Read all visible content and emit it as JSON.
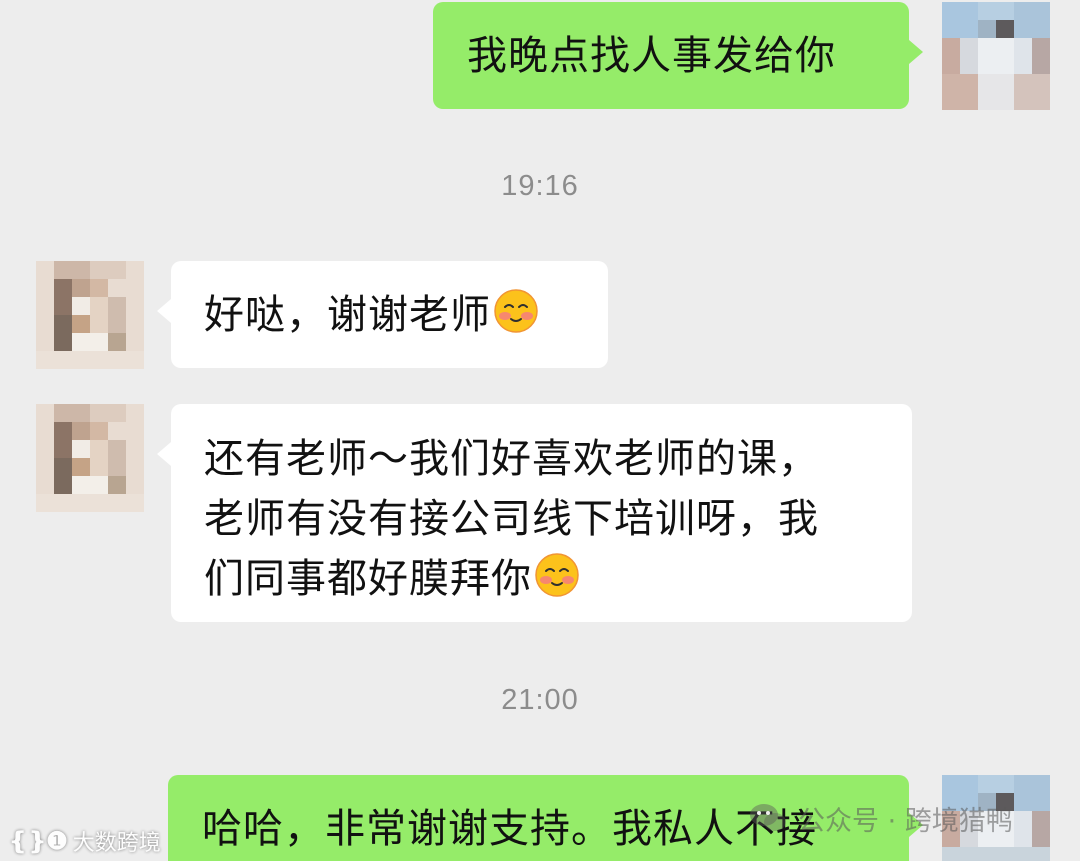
{
  "messages": [
    {
      "direction": "outgoing",
      "text": "我晚点找人事发给你"
    },
    {
      "direction": "incoming",
      "text": "好哒，谢谢老师",
      "emoji": "smiling-face-with-blush-emoji"
    },
    {
      "direction": "incoming",
      "lines": [
        "还有老师～我们好喜欢老师的课，",
        "老师有没有接公司线下培训呀，我",
        "们同事都好膜拜你"
      ],
      "emoji": "smiling-face-with-blush-emoji"
    },
    {
      "direction": "outgoing",
      "text": "哈哈，非常谢谢支持。我私人不接"
    }
  ],
  "timestamps": [
    "19:16",
    "21:00"
  ],
  "watermarks": {
    "left_logo": "❴❵❶",
    "left_text": "大数跨境",
    "right_text": "公众号 · 跨境猎鸭"
  },
  "colors": {
    "background": "#ededed",
    "outgoing_bubble": "#95ec69",
    "incoming_bubble": "#ffffff",
    "timestamp": "#8c8c8c"
  }
}
